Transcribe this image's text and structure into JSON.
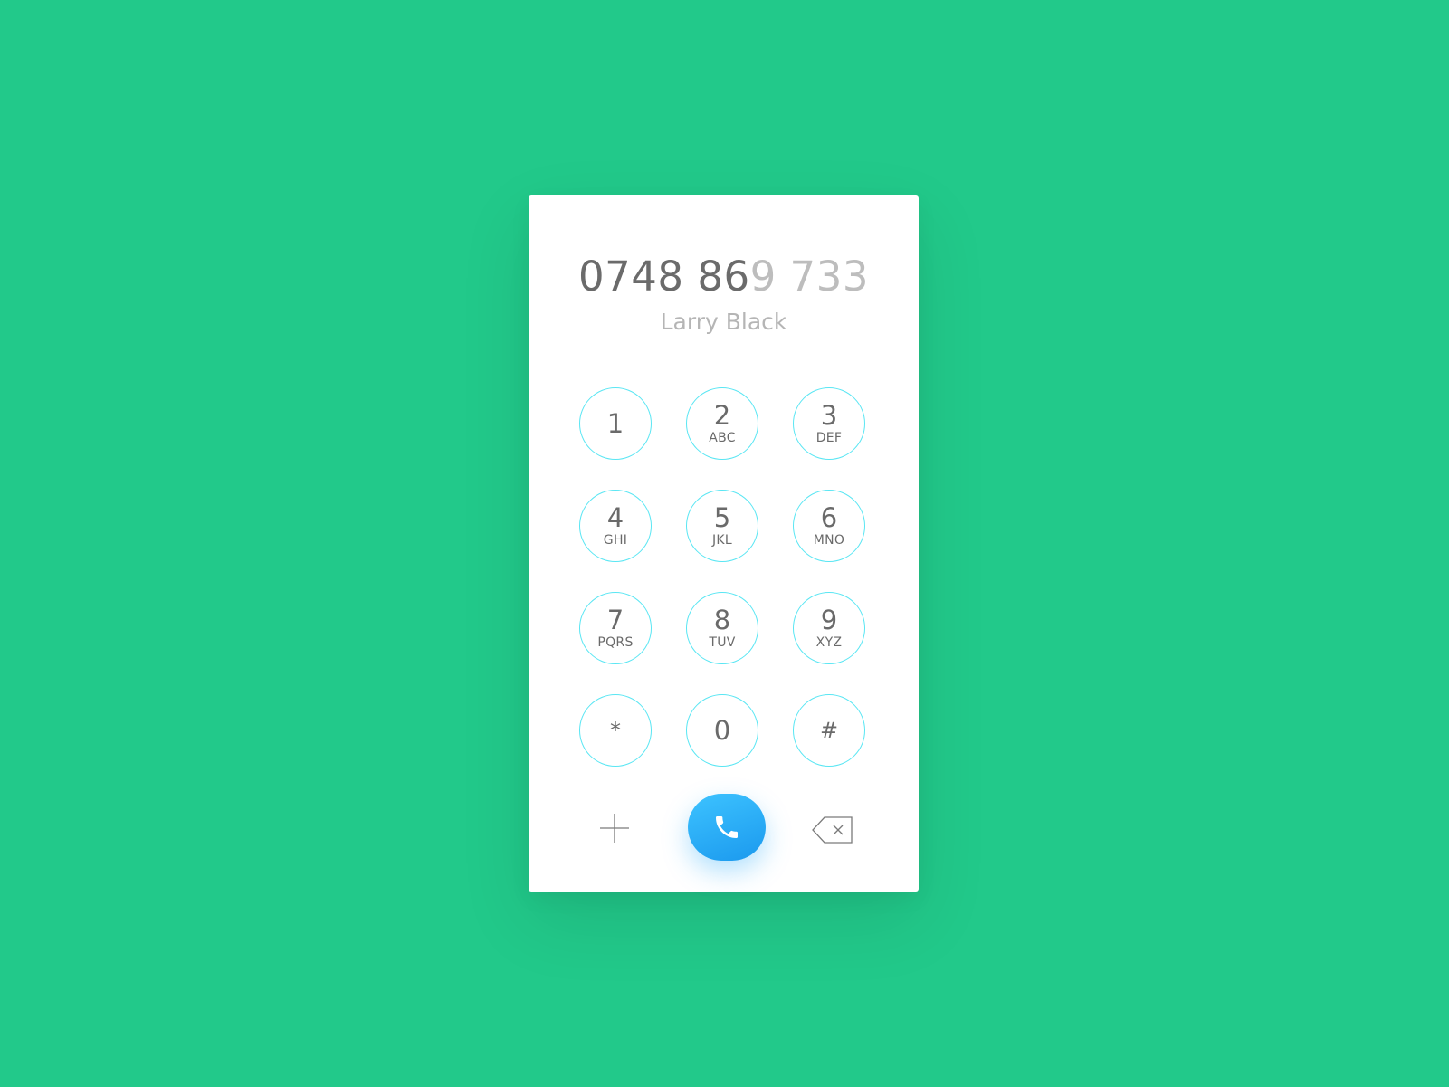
{
  "dialer": {
    "number_typed": "0748 86",
    "number_pending": "9 733",
    "contact_name": "Larry Black",
    "keys": [
      {
        "digit": "1",
        "letters": ""
      },
      {
        "digit": "2",
        "letters": "ABC"
      },
      {
        "digit": "3",
        "letters": "DEF"
      },
      {
        "digit": "4",
        "letters": "GHI"
      },
      {
        "digit": "5",
        "letters": "JKL"
      },
      {
        "digit": "6",
        "letters": "MNO"
      },
      {
        "digit": "7",
        "letters": "PQRS"
      },
      {
        "digit": "8",
        "letters": "TUV"
      },
      {
        "digit": "9",
        "letters": "XYZ"
      },
      {
        "digit": "*",
        "letters": ""
      },
      {
        "digit": "0",
        "letters": ""
      },
      {
        "digit": "#",
        "letters": ""
      }
    ],
    "actions": {
      "add_icon": "plus-icon",
      "call_icon": "phone-icon",
      "delete_icon": "backspace-icon"
    }
  },
  "colors": {
    "background": "#22c98a",
    "card": "#ffffff",
    "key_border": "#59e6f3",
    "call_button": "#28aaf6",
    "text_primary": "#6b6b6b",
    "text_secondary": "#bdbdbd"
  }
}
